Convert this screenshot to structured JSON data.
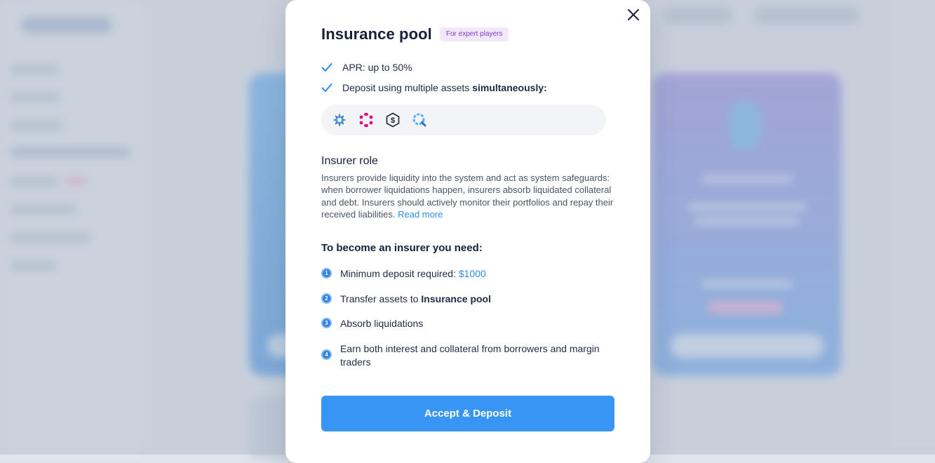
{
  "modal": {
    "title": "Insurance pool",
    "badge": "For expert players",
    "close_icon": "close-icon",
    "features": [
      {
        "icon": "check-icon",
        "text": "APR: up to 50%",
        "bold": ""
      },
      {
        "icon": "check-icon",
        "text": "Deposit using multiple assets ",
        "bold": "simultaneously:"
      }
    ],
    "assets": [
      "asset-1-icon",
      "polkadot-icon",
      "stablecoin-icon",
      "asset-4-icon"
    ],
    "insurer_role": {
      "heading": "Insurer role",
      "text": "Insurers provide liquidity into the system and act as system safeguards: when borrower liquidations happen, insurers absorb liquidated collateral and debt. Insurers should actively monitor their portfolios and repay their received liabilities. ",
      "link": "Read more"
    },
    "requirements": {
      "heading": "To become an insurer you need:",
      "steps": [
        {
          "num": "1",
          "text": "Minimum deposit required: ",
          "highlight": "$1000",
          "bold": ""
        },
        {
          "num": "2",
          "text": "Transfer assets to ",
          "highlight": "",
          "bold": "Insurance pool"
        },
        {
          "num": "3",
          "text": "Absorb liquidations",
          "highlight": "",
          "bold": ""
        },
        {
          "num": "4",
          "text": "Earn both interest and collateral from borrowers and margin traders",
          "highlight": "",
          "bold": ""
        }
      ]
    },
    "cta_label": "Accept & Deposit"
  },
  "colors": {
    "accent": "#3995f3",
    "link": "#2d8cf0",
    "badge_bg": "#f3e8fb",
    "badge_text": "#7a3fc4",
    "title": "#16203a"
  }
}
